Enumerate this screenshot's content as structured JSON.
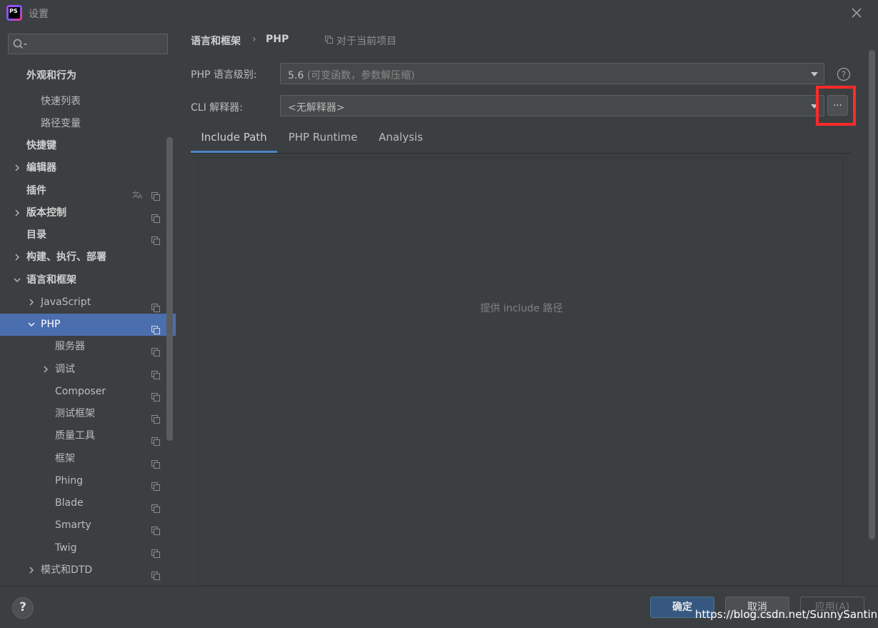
{
  "window": {
    "title": "设置",
    "app_icon_text": "PS"
  },
  "sidebar": {
    "search_placeholder": "",
    "items": [
      {
        "label": "外观和行为",
        "level": 0,
        "bold": true,
        "arrow": "",
        "project": false,
        "translate": false
      },
      {
        "label": "快速列表",
        "level": 1,
        "bold": false,
        "arrow": "",
        "project": false,
        "translate": false
      },
      {
        "label": "路径变量",
        "level": 1,
        "bold": false,
        "arrow": "",
        "project": false,
        "translate": false
      },
      {
        "label": "快捷键",
        "level": 0,
        "bold": true,
        "arrow": "",
        "project": false,
        "translate": false
      },
      {
        "label": "编辑器",
        "level": 0,
        "bold": true,
        "arrow": "right",
        "project": false,
        "translate": false
      },
      {
        "label": "插件",
        "level": 0,
        "bold": true,
        "arrow": "",
        "project": true,
        "translate": true
      },
      {
        "label": "版本控制",
        "level": 0,
        "bold": true,
        "arrow": "right",
        "project": true,
        "translate": false
      },
      {
        "label": "目录",
        "level": 0,
        "bold": true,
        "arrow": "",
        "project": true,
        "translate": false
      },
      {
        "label": "构建、执行、部署",
        "level": 0,
        "bold": true,
        "arrow": "right",
        "project": false,
        "translate": false
      },
      {
        "label": "语言和框架",
        "level": 0,
        "bold": true,
        "arrow": "down",
        "project": false,
        "translate": false
      },
      {
        "label": "JavaScript",
        "level": 1,
        "bold": false,
        "arrow": "right",
        "project": true,
        "translate": false
      },
      {
        "label": "PHP",
        "level": 1,
        "bold": false,
        "arrow": "down",
        "project": true,
        "translate": false,
        "selected": true
      },
      {
        "label": "服务器",
        "level": 2,
        "bold": false,
        "arrow": "",
        "project": true,
        "translate": false
      },
      {
        "label": "调试",
        "level": 2,
        "bold": false,
        "arrow": "right",
        "project": true,
        "translate": false
      },
      {
        "label": "Composer",
        "level": 2,
        "bold": false,
        "arrow": "",
        "project": true,
        "translate": false
      },
      {
        "label": "测试框架",
        "level": 2,
        "bold": false,
        "arrow": "",
        "project": true,
        "translate": false
      },
      {
        "label": "质量工具",
        "level": 2,
        "bold": false,
        "arrow": "",
        "project": true,
        "translate": false
      },
      {
        "label": "框架",
        "level": 2,
        "bold": false,
        "arrow": "",
        "project": true,
        "translate": false
      },
      {
        "label": "Phing",
        "level": 2,
        "bold": false,
        "arrow": "",
        "project": true,
        "translate": false
      },
      {
        "label": "Blade",
        "level": 2,
        "bold": false,
        "arrow": "",
        "project": true,
        "translate": false
      },
      {
        "label": "Smarty",
        "level": 2,
        "bold": false,
        "arrow": "",
        "project": true,
        "translate": false
      },
      {
        "label": "Twig",
        "level": 2,
        "bold": false,
        "arrow": "",
        "project": true,
        "translate": false
      },
      {
        "label": "模式和DTD",
        "level": 1,
        "bold": false,
        "arrow": "right",
        "project": true,
        "translate": false
      }
    ]
  },
  "breadcrumb": {
    "parent": "语言和框架",
    "separator": "›",
    "current": "PHP",
    "scope": "对于当前项目"
  },
  "form": {
    "language_level_label": "PHP 语言级别:",
    "language_level_value": "5.6",
    "language_level_hint": "(可变函数，参数解压缩)",
    "cli_label": "CLI 解释器:",
    "cli_value": "<无解释器>",
    "dots_button": "..."
  },
  "tabs": [
    {
      "label": "Include Path",
      "active": true
    },
    {
      "label": "PHP Runtime",
      "active": false
    },
    {
      "label": "Analysis",
      "active": false
    }
  ],
  "panel": {
    "empty_text": "提供 include 路径"
  },
  "footer": {
    "help": "?",
    "ok": "确定",
    "cancel": "取消",
    "apply": "应用(A)",
    "watermark": "https://blog.csdn.net/SunnySantino"
  },
  "colors": {
    "selection": "#4b6eaf",
    "highlight_box": "#ff2a2a",
    "ok_button": "#365880"
  }
}
